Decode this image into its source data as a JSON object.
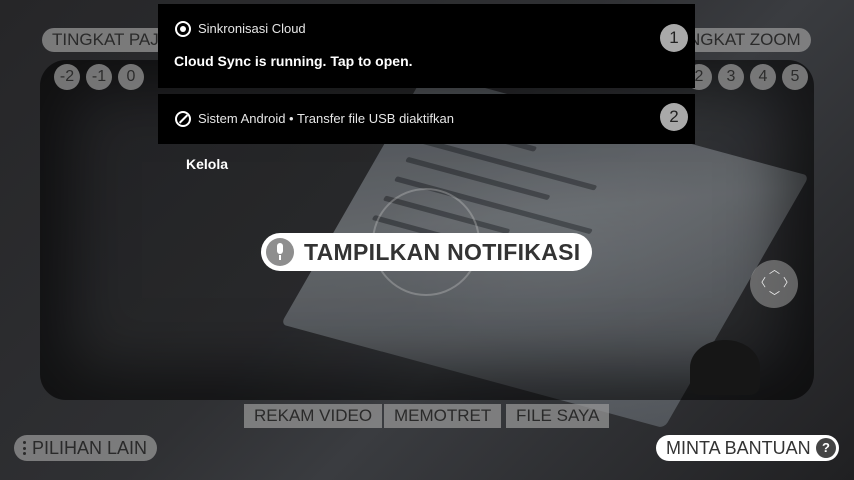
{
  "top_left_label": "TINGKAT PAJ",
  "top_right_label": "NGKAT ZOOM",
  "exposure_levels": [
    "-2",
    "-1",
    "0"
  ],
  "zoom_levels": [
    "2",
    "3",
    "4",
    "5"
  ],
  "notifications": [
    {
      "app": "Sinkronisasi Cloud",
      "text": "Cloud Sync is running. Tap to open.",
      "badge": "1"
    },
    {
      "app": "Sistem Android • Transfer file USB diaktifkan",
      "badge": "2"
    }
  ],
  "kelola_label": "Kelola",
  "voice_command": "TAMPILKAN NOTIFIKASI",
  "bottom_actions": [
    "REKAM VIDEO",
    "MEMOTRET",
    "FILE SAYA"
  ],
  "more_options": "PILIHAN LAIN",
  "help": "MINTA BANTUAN",
  "help_icon_glyph": "?",
  "colors": {
    "notification_bg": "#000000",
    "chip_bg": "#ffffff",
    "pill_bg": "#969696"
  },
  "icons": [
    "cloud-sync-icon",
    "android-system-icon",
    "microphone-icon",
    "directional-pad-icon",
    "more-options-icon",
    "help-icon"
  ]
}
